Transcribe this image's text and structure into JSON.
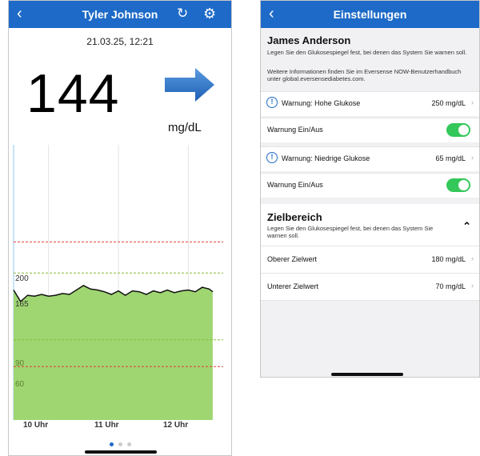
{
  "left": {
    "header": {
      "back_icon": "chevron-left-icon",
      "title": "Tyler Johnson",
      "refresh_icon": "refresh-icon",
      "settings_icon": "gear-icon"
    },
    "datetime": "21.03.25, 12:21",
    "glucose_value": "144",
    "unit": "mg/dL",
    "trend": "arrow-right-icon",
    "page_dots": {
      "count": 3,
      "active": 0
    },
    "colors": {
      "accent": "#1d6ac8",
      "fill": "#9fd672",
      "high_line": "#e63b3b",
      "target_line": "#8dbb36"
    }
  },
  "chart_data": {
    "type": "area",
    "x_tick_labels": [
      "10 Uhr",
      "11 Uhr",
      "12 Uhr"
    ],
    "y_reference_labels": [
      "200",
      "165",
      "90",
      "60"
    ],
    "thresholds": {
      "high_alert": 200,
      "target_high": 165,
      "target_low": 90,
      "low_alert": 60
    },
    "ylim": [
      0,
      300
    ],
    "x_hours": [
      9.5,
      9.6,
      9.7,
      9.8,
      9.9,
      10.0,
      10.1,
      10.2,
      10.3,
      10.4,
      10.5,
      10.6,
      10.7,
      10.8,
      10.9,
      11.0,
      11.1,
      11.2,
      11.3,
      11.4,
      11.5,
      11.6,
      11.7,
      11.8,
      11.9,
      12.0,
      12.1,
      12.2,
      12.3,
      12.35
    ],
    "values": [
      146,
      133,
      140,
      139,
      141,
      139,
      140,
      142,
      141,
      146,
      151,
      147,
      146,
      144,
      141,
      145,
      140,
      145,
      144,
      141,
      145,
      143,
      146,
      143,
      145,
      146,
      144,
      149,
      147,
      144
    ],
    "grid": true
  },
  "right": {
    "header": {
      "back_icon": "chevron-left-icon",
      "title": "Einstellungen"
    },
    "name": "James Anderson",
    "intro": "Legen Sie den Glukosespiegel fest, bei denen das System Sie warnen soll.",
    "info": "Weitere Informationen finden Sie im Eversense NOW-Benutzerhandbuch unter global.eversensediabetes.com.",
    "high_warning": {
      "label": "Warnung: Hohe Glukose",
      "value": "250 mg/dL"
    },
    "high_toggle": {
      "label": "Warnung Ein/Aus",
      "on": true
    },
    "low_warning": {
      "label": "Warnung: Niedrige Glukose",
      "value": "65 mg/dL"
    },
    "low_toggle": {
      "label": "Warnung Ein/Aus",
      "on": true
    },
    "target": {
      "title": "Zielbereich",
      "desc": "Legen Sie den Glukosespiegel fest, bei denen das System Sie warnen soll.",
      "upper": {
        "label": "Oberer Zielwert",
        "value": "180 mg/dL"
      },
      "lower": {
        "label": "Unterer Zielwert",
        "value": "70 mg/dL"
      }
    }
  }
}
